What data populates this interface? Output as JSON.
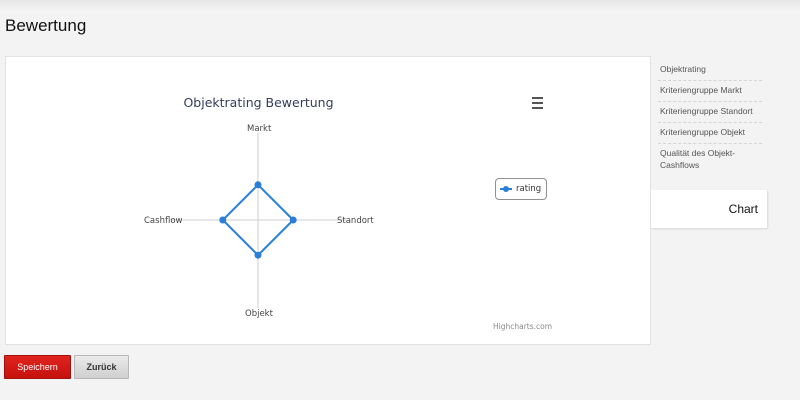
{
  "page": {
    "title": "Bewertung"
  },
  "chart_data": {
    "type": "radar",
    "title": "Objektrating Bewertung",
    "categories": [
      "Markt",
      "Standort",
      "Objekt",
      "Cashflow"
    ],
    "series": [
      {
        "name": "rating",
        "values": [
          2,
          2,
          2,
          2
        ],
        "color": "#2b7fdb"
      }
    ],
    "ylim": [
      0,
      5
    ],
    "legend_position": "right",
    "credits": "Highcharts.com"
  },
  "sidebar": {
    "items": [
      {
        "label": "Objektrating"
      },
      {
        "label": "Kriteriengruppe Markt"
      },
      {
        "label": "Kriteriengruppe Standort"
      },
      {
        "label": "Kriteriengruppe Objekt"
      },
      {
        "label": "Qualität des Objekt-Cashflows"
      }
    ],
    "active_tab": "Chart"
  },
  "buttons": {
    "save": "Speichern",
    "back": "Zurück"
  },
  "colors": {
    "primary": "#d51a15",
    "series": "#2b7fdb"
  }
}
